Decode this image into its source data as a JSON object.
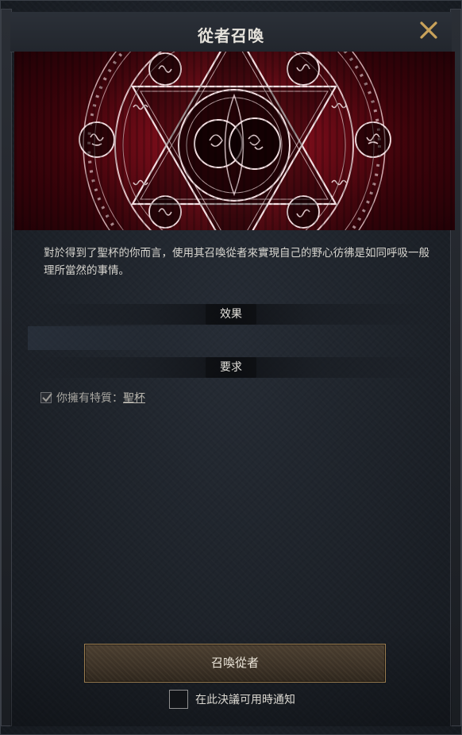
{
  "window": {
    "title": "從者召喚",
    "close_icon": "close-x-icon"
  },
  "banner": {
    "image": "summoning-magic-circle",
    "accent": "#8b0e1f"
  },
  "description": "對於得到了聖杯的你而言，使用其召喚從者來實現自己的野心彷彿是如同呼吸一般理所當然的事情。",
  "sections": {
    "effect_label": "效果",
    "requirement_label": "要求"
  },
  "requirements": [
    {
      "prefix": "你擁有特質：",
      "link": "聖杯",
      "met": true
    }
  ],
  "footer": {
    "summon_button": "召喚從者",
    "notify_label": "在此決議可用時通知",
    "notify_checked": false
  },
  "colors": {
    "button_border": "#9a7c4f",
    "title_text": "#e6e3dc"
  }
}
